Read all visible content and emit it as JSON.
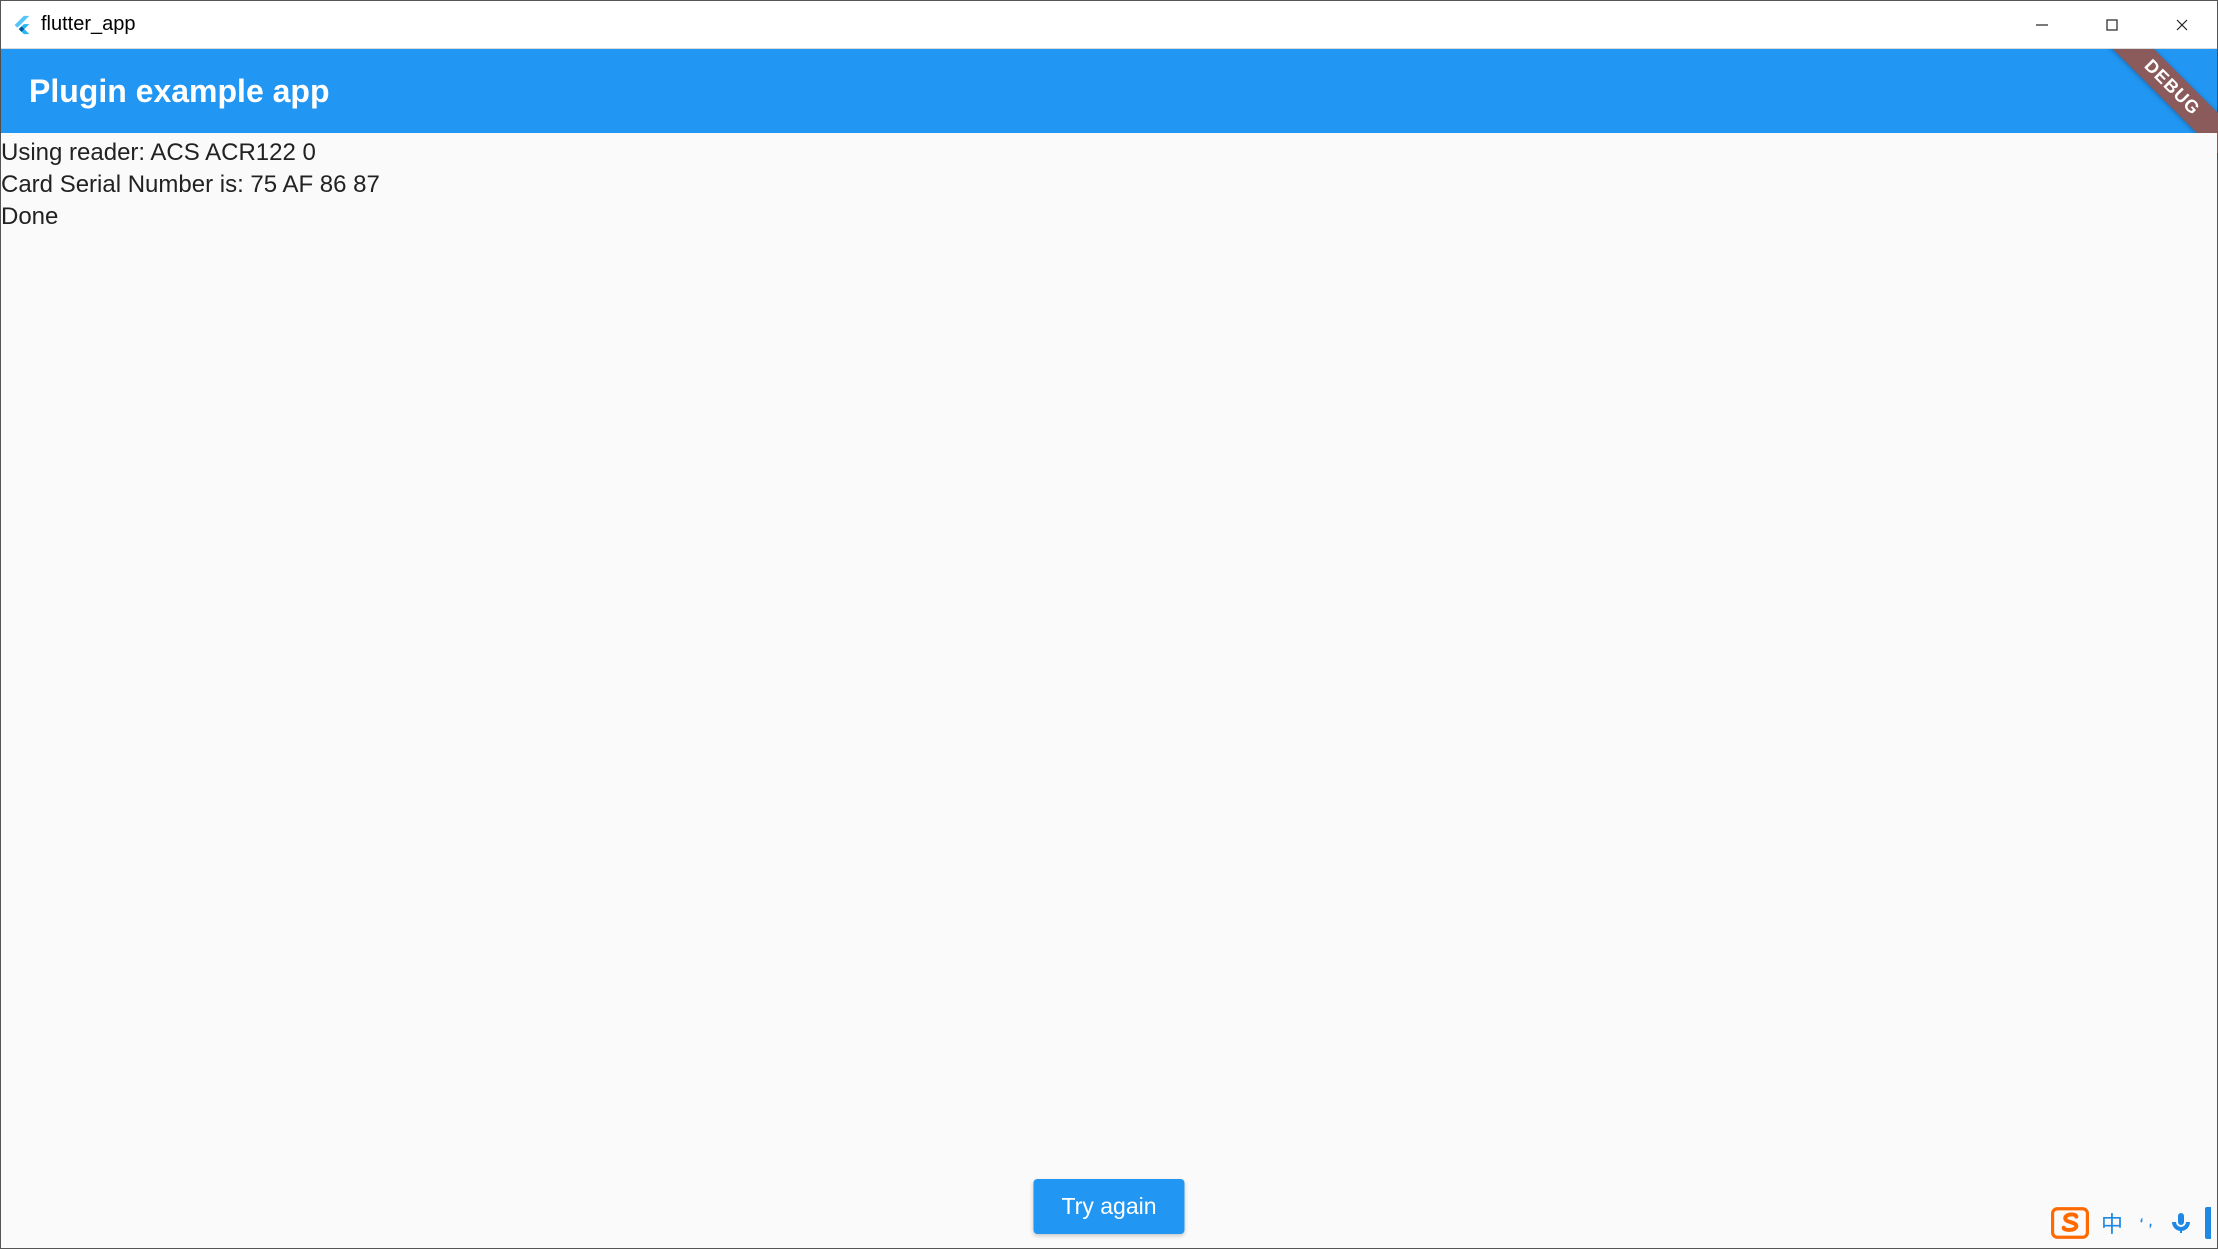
{
  "window": {
    "title": "flutter_app"
  },
  "appbar": {
    "title": "Plugin example app"
  },
  "debug_banner": {
    "label": "DEBUG"
  },
  "content": {
    "lines": [
      "Using reader: ACS ACR122 0",
      "Card Serial Number is: 75 AF 86 87",
      "Done"
    ]
  },
  "button": {
    "try_again_label": "Try again"
  },
  "ime": {
    "lang_label": "中"
  },
  "colors": {
    "primary": "#2196F3",
    "debug_banner": "#8B5A5A",
    "ime_blue": "#1E88E5",
    "sogou_orange": "#FF6A00"
  }
}
